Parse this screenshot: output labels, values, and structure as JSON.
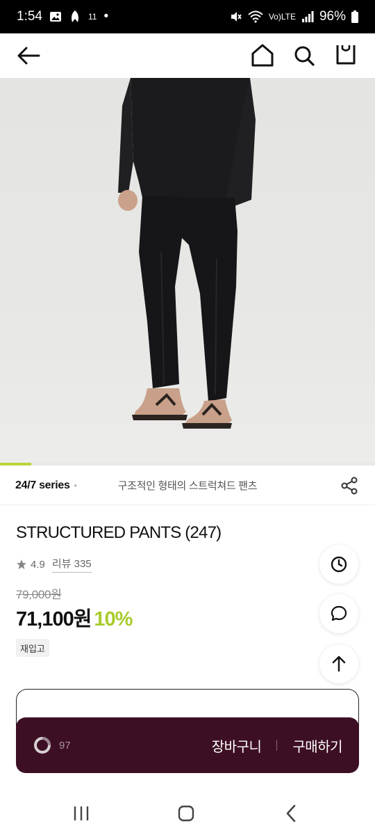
{
  "status_bar": {
    "time": "1:54",
    "carrier_label": "11",
    "dot": "•",
    "network_label": "Vo)",
    "network_sub": "LTE",
    "battery_percent": "96%"
  },
  "nav": {
    "back_icon": "back-arrow-icon",
    "home_icon": "home-icon",
    "search_icon": "search-icon",
    "bag_icon": "shopping-bag-icon"
  },
  "gallery": {
    "image_description_icon": "product-photo",
    "progress": 0.083
  },
  "series": {
    "name": "24/7 series",
    "dot": "•",
    "description": "구조적인 형태의 스트럭쳐드 팬츠"
  },
  "product": {
    "title": "STRUCTURED PANTS (247)",
    "rating": "4.9",
    "review_label": "리뷰 335",
    "original_price": "79,000원",
    "sale_price": "71,100원",
    "discount": "10%",
    "badge": "재입고"
  },
  "buy_bar": {
    "like_count": "97",
    "cart_label": "장바구니",
    "buy_label": "구매하기"
  },
  "colors": {
    "accent_green": "#a8cc2c",
    "buy_bar_bg": "#3d0f24"
  }
}
